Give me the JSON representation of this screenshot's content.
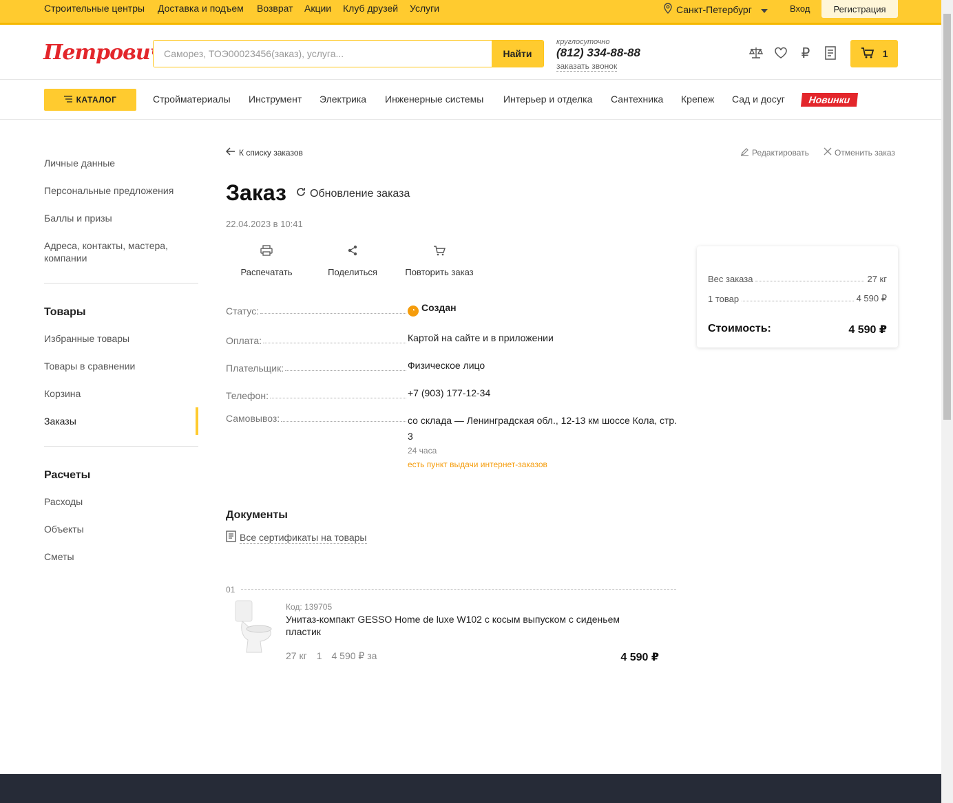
{
  "topbar": {
    "links": [
      "Строительные центры",
      "Доставка и подъем",
      "Возврат",
      "Акции",
      "Клуб друзей",
      "Услуги"
    ],
    "city": "Санкт-Петербург",
    "login": "Вход",
    "register": "Регистрация"
  },
  "header": {
    "logo": "Петрович",
    "search_placeholder": "Саморез, ТОЭ00023456(заказ), услуга...",
    "search_button": "Найти",
    "phone_sub": "круглосуточно",
    "phone": "(812) 334-88-88",
    "callback": "заказать звонок",
    "cart_count": "1",
    "icons": [
      "compare-icon",
      "heart-icon",
      "ruble-icon",
      "document-icon",
      "cart-icon"
    ]
  },
  "catnav": {
    "catalog": "КАТАЛОГ",
    "links": [
      "Стройматериалы",
      "Инструмент",
      "Электрика",
      "Инженерные системы",
      "Интерьер и отделка",
      "Сантехника",
      "Крепеж",
      "Сад и досуг"
    ],
    "new_badge": "Новинки"
  },
  "sidebar": {
    "top_items": [
      "Личные данные",
      "Персональные предложения",
      "Баллы и призы",
      "Адреса, контакты, мастера, компании"
    ],
    "goods_title": "Товары",
    "goods_items": [
      "Избранные товары",
      "Товары в сравнении",
      "Корзина",
      "Заказы"
    ],
    "calc_title": "Расчеты",
    "calc_items": [
      "Расходы",
      "Объекты",
      "Сметы"
    ]
  },
  "order": {
    "back": "К списку заказов",
    "edit": "Редактировать",
    "cancel": "Отменить заказ",
    "title": "Заказ",
    "update": "Обновление заказа",
    "date": "22.04.2023 в 10:41",
    "actions": [
      "Распечатать",
      "Поделиться",
      "Повторить заказ"
    ],
    "fields": {
      "status_label": "Статус:",
      "status_value": "Создан",
      "payment_label": "Оплата:",
      "payment_value": "Картой на сайте и в приложении",
      "payer_label": "Плательщик:",
      "payer_value": "Физическое лицо",
      "phone_label": "Телефон:",
      "phone_value": "+7 (903) 177-12-34",
      "pickup_label": "Самовывоз:",
      "pickup_value": "со склада — Ленинградская обл., 12-13 км шоссе Кола, стр. 3",
      "pickup_hours": "24 часа",
      "pickup_note": "есть пункт выдачи интернет-заказов"
    },
    "docs_title": "Документы",
    "docs_link": "Все сертификаты на товары"
  },
  "product": {
    "index": "01",
    "code": "Код: 139705",
    "name": "Унитаз-компакт GESSO Home de luxe W102 с косым выпуском с сиденьем пластик",
    "weight": "27 кг",
    "qty": "1",
    "unit_price": "4 590 ₽ за",
    "total": "4 590 ₽"
  },
  "summary": {
    "weight_label": "Вес заказа",
    "weight_value": "27 кг",
    "items_label": "1 товар",
    "items_value": "4 590 ₽",
    "total_label": "Стоимость:",
    "total_value": "4 590 ₽"
  }
}
